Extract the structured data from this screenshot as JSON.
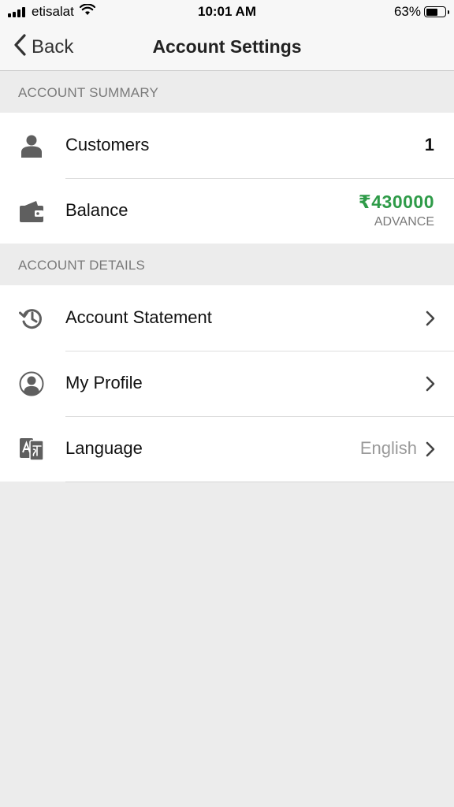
{
  "status_bar": {
    "carrier": "etisalat",
    "time": "10:01 AM",
    "battery_percent": "63%",
    "battery_level": 0.63,
    "icons": [
      "signal-icon",
      "wifi-icon",
      "battery-icon"
    ]
  },
  "nav": {
    "back_label": "Back",
    "title": "Account Settings",
    "back_icon": "chevron-left-icon"
  },
  "summary": {
    "header": "ACCOUNT SUMMARY",
    "customers": {
      "label": "Customers",
      "value": "1",
      "icon": "person-icon"
    },
    "balance": {
      "label": "Balance",
      "amount": "₹430000",
      "status": "ADVANCE",
      "amount_color": "#2e9b48",
      "icon": "wallet-icon"
    }
  },
  "details": {
    "header": "ACCOUNT DETAILS",
    "statement": {
      "label": "Account Statement",
      "icon": "history-icon"
    },
    "profile": {
      "label": "My Profile",
      "icon": "profile-circle-icon"
    },
    "language": {
      "label": "Language",
      "value": "English",
      "icon": "translate-icon"
    }
  }
}
